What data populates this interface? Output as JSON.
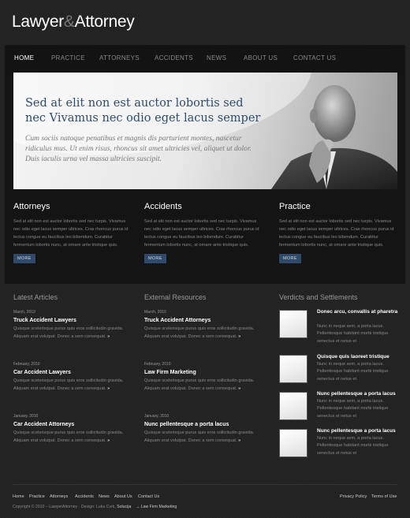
{
  "logo": {
    "part1": "Lawyer",
    "amp": "&",
    "part2": "Attorney"
  },
  "nav": [
    "HOME",
    "PRACTICE",
    "ATTORNEYS",
    "ACCIDENTS",
    "NEWS",
    "ABOUT US",
    "CONTACT US"
  ],
  "hero": {
    "headline": "Sed at elit non est auctor lobortis sed nec Vivamus nec odio eget lacus semper",
    "text": "Cum sociis natoque penatibus et magnis dis parturient montes, nascetur ridiculus mus. Ut enim risus, rhoncus sit amet ultricies vel, aliquet ut dolor. Duis iaculis urna vel massa ultricies suscipit."
  },
  "columns": [
    {
      "title": "Attorneys",
      "text": "Sed at elit non est auctor lobortis sed nec turpis. Vivamus nec odio eget lacus semper ultrices. Cras rhoncus purus id lectus congue eu faucibus leo bibendum. Curabitur fermentum lobortis nunc, at ornare ante tristique quis.",
      "button": "MORE"
    },
    {
      "title": "Accidents",
      "text": "Sed at elit non est auctor lobortis sed nec turpis. Vivamus nec odio eget lacus semper ultrices. Cras rhoncus purus id lectus congue eu faucibus leo bibendum. Curabitur fermentum lobortis nunc, at ornare ante tristique quis.",
      "button": "MORE"
    },
    {
      "title": "Practice",
      "text": "Sed at elit non est auctor lobortis sed nec turpis. Vivamus nec odio eget lacus semper ultrices. Cras rhoncus purus id lectus congue eu faucibus leo bibendum. Curabitur fermentum lobortis nunc, at ornare ante tristique quis.",
      "button": "MORE"
    }
  ],
  "latest": {
    "title": "Latest Articles",
    "items": [
      {
        "date": "March, 2010",
        "title": "Truck Accident Lawyers",
        "text": "Quisque scelerisque purus quis eros sollicitudin gravida. Aliquam erat volutpat. Donec a sem consequat."
      },
      {
        "date": "February, 2010",
        "title": "Car Accident Lawyers",
        "text": "Quisque scelerisque purus quis eros sollicitudin gravida. Aliquam erat volutpat. Donec a sem consequat."
      },
      {
        "date": "January, 2010",
        "title": "Car Accident Attorneys",
        "text": "Quisque scelerisque purus quis eros sollicitudin gravida. Aliquam erat volutpat. Donec a sem consequat."
      }
    ]
  },
  "external": {
    "title": "External Resources",
    "items": [
      {
        "date": "March, 2010",
        "title": "Truck Accident Attorneys",
        "text": "Quisque scelerisque purus quis eros sollicitudin gravida. Aliquam erat volutpat. Donec a sem consequat."
      },
      {
        "date": "February, 2010",
        "title": "Law Firm Marketing",
        "text": "Quisque scelerisque purus quis eros sollicitudin gravida. Aliquam erat volutpat. Donec a sem consequat."
      },
      {
        "date": "January, 2010",
        "title": "Nunc pellentesque a porta lacus",
        "text": "Quisque scelerisque purus quis eros sollicitudin gravida. Aliquam erat volutpat. Donec a sem consequat."
      }
    ]
  },
  "verdicts": {
    "title": "Verdicts and Settlements",
    "items": [
      {
        "title": "Donec arcu, convallis at pharetra",
        "text": "Nunc in neque sem, a porta lacus. Pellentesque habitant morbi tristique senectus et netus et"
      },
      {
        "title": "Quisque quis laoreet tristique",
        "text": "Nunc in neque sem, a porta lacus. Pellentesque habitant morbi tristique senectus et netus et"
      },
      {
        "title": "Nunc pellentesque a porta lacus",
        "text": "Nunc in neque sem, a porta lacus. Pellentesque habitant morbi tristique senectus et netus et"
      },
      {
        "title": "Nunc pellentesque a porta lacus",
        "text": "Nunc in neque sem, a porta lacus. Pellentesque habitant morbi tristique senectus et netus et"
      }
    ]
  },
  "more_arrow": "»",
  "footer": {
    "left_links": [
      "Home",
      "Practice",
      "Attorneys",
      "Accidents",
      "News",
      "About Us",
      "Contact Us"
    ],
    "right_links": [
      "Privacy Policy",
      "Terms of Use"
    ],
    "copyright": "Copyright © 2010 – LawyerAttorney · Design: Luka Cvrk,",
    "solucija": "Solucija",
    "marketing": "→ Law Firm Marketing"
  },
  "colors": {
    "background": "#222222",
    "nav_bg": "#131313",
    "accent_blue": "#2f4968",
    "headline_blue": "#2f4d6e"
  }
}
